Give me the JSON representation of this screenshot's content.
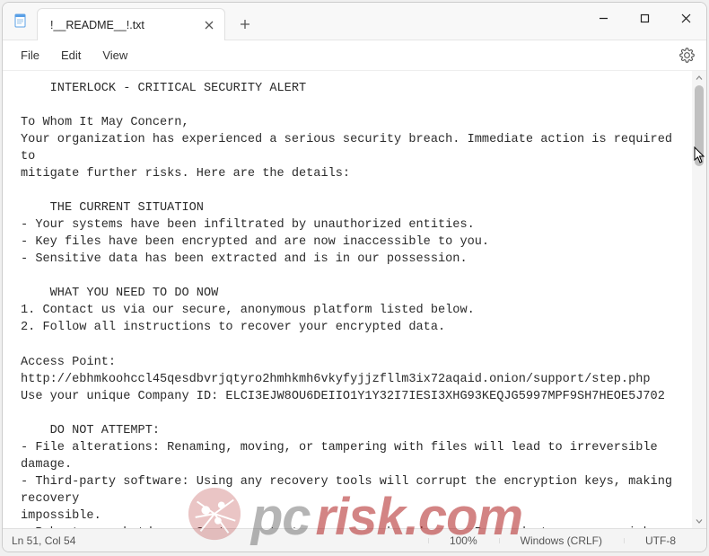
{
  "window": {
    "tab_title": "!__README__!.txt",
    "controls": {
      "minimize": "–",
      "maximize": "▢",
      "close": "✕"
    }
  },
  "menubar": {
    "file": "File",
    "edit": "Edit",
    "view": "View"
  },
  "document": {
    "text": "    INTERLOCK - CRITICAL SECURITY ALERT\n\nTo Whom It May Concern,\nYour organization has experienced a serious security breach. Immediate action is required to\nmitigate further risks. Here are the details:\n\n    THE CURRENT SITUATION\n- Your systems have been infiltrated by unauthorized entities.\n- Key files have been encrypted and are now inaccessible to you.\n- Sensitive data has been extracted and is in our possession.\n\n    WHAT YOU NEED TO DO NOW\n1. Contact us via our secure, anonymous platform listed below.\n2. Follow all instructions to recover your encrypted data.\n\nAccess Point: http://ebhmkoohccl45qesdbvrjqtyro2hmhkmh6vkyfyjjzfllm3ix72aqaid.onion/support/step.php\nUse your unique Company ID: ELCI3EJW8OU6DEIIO1Y1Y32I7IESI3XHG93KEQJG5997MPF9SH7HEOE5J702\n\n    DO NOT ATTEMPT:\n- File alterations: Renaming, moving, or tampering with files will lead to irreversible damage.\n- Third-party software: Using any recovery tools will corrupt the encryption keys, making recovery\nimpossible.\n- Reboots or shutdowns: System restarts may cause key damage. Proceed at your own risk.\n\n    HOW DID THIS HAPPEN?\nWe identified vulnerabilities within your network and gained access to critical parts of your\ninfrastructure. The following data categories have been extracted and are now at risk:\n- Personal records and client information\n- Financial statements, contracts, and legal documents\n- Internal communications\n- Backups and business-critical files"
  },
  "statusbar": {
    "position": "Ln 51, Col 54",
    "zoom": "100%",
    "line_endings": "Windows (CRLF)",
    "encoding": "UTF-8"
  },
  "watermark": {
    "brand_prefix": "pc",
    "brand_suffix": "risk.com"
  }
}
